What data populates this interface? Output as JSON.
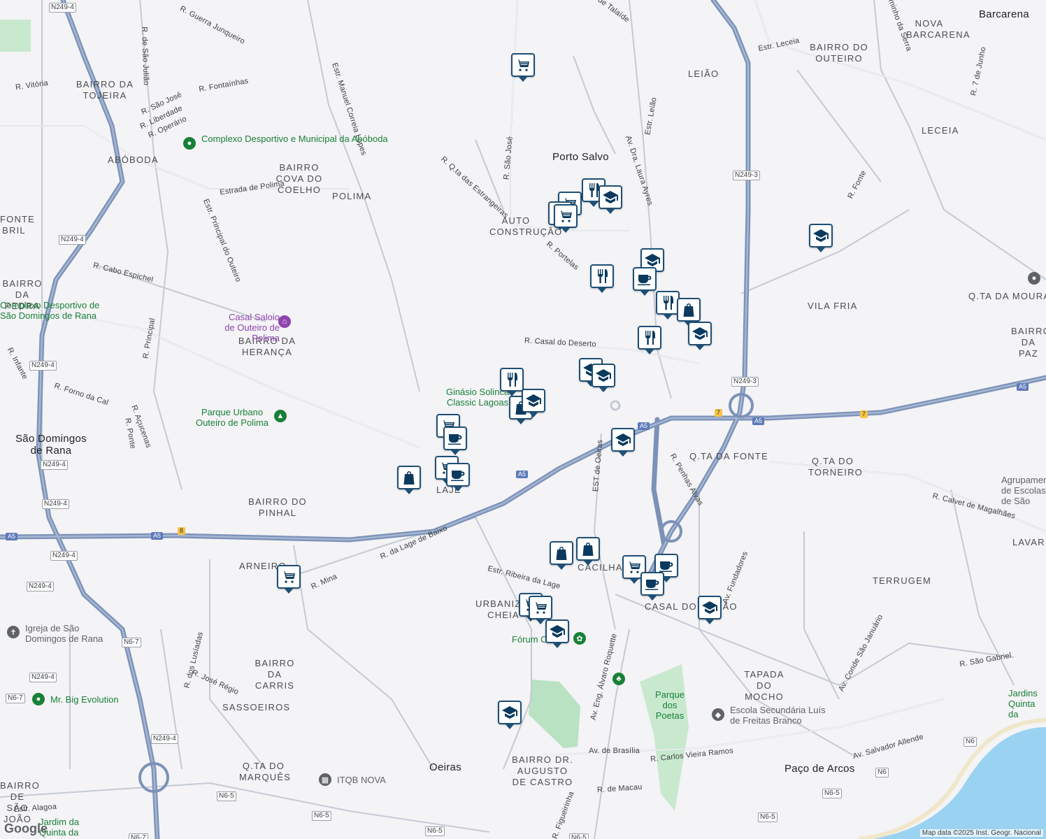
{
  "map": {
    "attribution": "Map data ©2025 Inst. Geogr. Nacional",
    "logo": "Google"
  },
  "towns": [
    {
      "text": "Barcarena",
      "cls": "town"
    },
    {
      "text": "Porto Salvo",
      "cls": "town"
    },
    {
      "text": "Oeiras",
      "cls": "town"
    },
    {
      "text": "Paço de Arcos",
      "cls": "town"
    },
    {
      "text": "São Domingos de Rana",
      "cls": "town"
    }
  ],
  "areas": [
    "NOVA BARCARENA",
    "BAIRRO DO OUTEIRO",
    "LEIÃO",
    "LECEIA",
    "VILA FRIA",
    "Q.TA DA MOURA",
    "BAIRRO DA TOJEIRA",
    "ABÓBODA",
    "BAIRRO COVA DO COELHO",
    "POLIMA",
    "AUTO CONSTRUÇÃO",
    "BAIRRO DA HERANÇA",
    "BAIRRO DA PEDRA",
    "BAIRRO DO PINHAL",
    "ARNEIRO",
    "Q.TA DA FONTE",
    "Q.TA DO TORNEIRO",
    "CACILHAS",
    "CASAL DO DEGÃO",
    "URBANIZAÇÃO CHEIA",
    "TERRUGEM",
    "TAPADA DO MOCHO",
    "BAIRRO DA CARRIS",
    "SASSOEIROS",
    "Q.TA DO MARQUÊS",
    "BAIRRO DE SÃO JOÃO",
    "BAIRRO DR. AUGUSTO DE CASTRO",
    "LAJE",
    "FONTE BRIL",
    "LAVAR",
    "BAIRRO DA PAZ"
  ],
  "streets": [
    "R. Guerra Junqueiro",
    "R. de São Julião",
    "R. Vitória",
    "R. Fontaínhas",
    "R. São José",
    "R. Liberdade",
    "R. Operário",
    "Estr. Manuel Correia Lopes",
    "Estrada de Polima",
    "Estr. Principal do Outeiro",
    "R. Cabo Espichel",
    "R. Principal",
    "R. Infante",
    "R. Forno da Cal",
    "R. Açucenas",
    "R. Ponte",
    "R. Q.ta das Estrangeiras",
    "R. São José",
    "Av. Dra. Laura Ayres",
    "Estr. Leião",
    "Estr. Leceia",
    "R. Fonte",
    "R. 7 de Junho",
    "R. Portelas",
    "R. Casal do Deserto",
    "EST de Oeiras",
    "R. Penhas Alvas",
    "R. Calvet de Magalhães",
    "Av. Fundadores",
    "R. da Lage de Baixo",
    "R. Mina",
    "Estr. Ribeira da Lage",
    "Av. Eng. Álvaro Roquette",
    "Av. Conde São Januário",
    "R. São Gabriel",
    "Av. Salvador Allende",
    "R. Carlos Vieira Ramos",
    "Av. de Brasília",
    "R. de Macau",
    "R. Figueirinha",
    "R. dos Lusíadas",
    "R. José Régio",
    "Estr. Alagoa",
    "R. de Talaíde",
    "minho da Serra"
  ],
  "pois": [
    {
      "text": "Complexo Desportivo e Municipal da Abóboda",
      "kind": "green"
    },
    {
      "text": "Complexo Desportivo de São Domingos de Rana",
      "kind": "green"
    },
    {
      "text": "Casal Saloio de Outeiro de Polima",
      "kind": "purple"
    },
    {
      "text": "Parque Urbano Outeiro de Polima",
      "kind": "green"
    },
    {
      "text": "Ginásio Solinca Classic Lagoas",
      "kind": "green"
    },
    {
      "text": "Fórum Oeiras",
      "kind": "green"
    },
    {
      "text": "Parque dos Poetas",
      "kind": "green"
    },
    {
      "text": "Escola Secundária Luís de Freitas Branco",
      "kind": "gray"
    },
    {
      "text": "Igreja de São Domingos de Rana",
      "kind": "gray"
    },
    {
      "text": "Mr. Big Evolution",
      "kind": "green"
    },
    {
      "text": "ITQB NOVA",
      "kind": "gray"
    },
    {
      "text": "Jardins Quinta da",
      "kind": "green"
    },
    {
      "text": "Jardim da Quinta da",
      "kind": "green"
    },
    {
      "text": "Agrupamento de Escolas de São",
      "kind": "gray"
    }
  ],
  "roads": [
    "N249-4",
    "N249-3",
    "A5",
    "N6-7",
    "N6-5",
    "N6",
    "7",
    "8"
  ],
  "markers": [
    "cart-icon",
    "restaurant-icon",
    "school-icon",
    "cart-icon",
    "cart-icon",
    "cart-icon",
    "school-icon",
    "school-icon",
    "restaurant-icon",
    "cafe-icon",
    "restaurant-icon",
    "shopping-bag-icon",
    "school-icon",
    "restaurant-icon",
    "school-icon",
    "school-icon",
    "restaurant-icon",
    "shopping-bag-icon",
    "school-icon",
    "cart-icon",
    "cafe-icon",
    "cart-icon",
    "cafe-icon",
    "shopping-bag-icon",
    "school-icon",
    "cart-icon",
    "shopping-bag-icon",
    "shopping-bag-icon",
    "cart-icon",
    "cafe-icon",
    "cafe-icon",
    "cart-icon",
    "cart-icon",
    "school-icon",
    "school-icon",
    "school-icon"
  ]
}
